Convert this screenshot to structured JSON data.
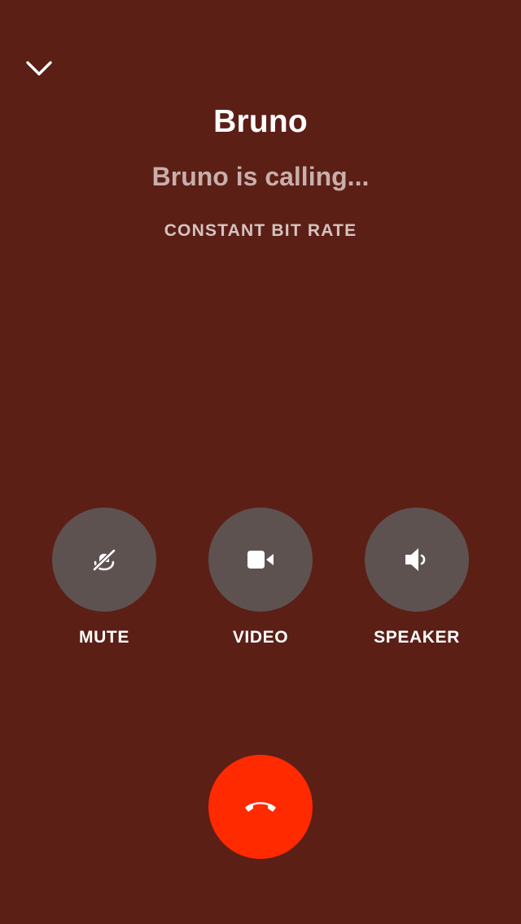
{
  "call": {
    "caller_name": "Bruno",
    "status": "Bruno is calling...",
    "quality": "CONSTANT BIT RATE"
  },
  "controls": [
    {
      "label": "MUTE",
      "icon": "mic-off-icon"
    },
    {
      "label": "VIDEO",
      "icon": "video-camera-icon"
    },
    {
      "label": "SPEAKER",
      "icon": "speaker-icon"
    }
  ],
  "actions": {
    "collapse_icon": "chevron-down-icon",
    "end_call_icon": "end-call-icon"
  },
  "colors": {
    "background": "#5b1f16",
    "control_button": "#5e5250",
    "end_call_button": "#ff2a00",
    "status_text": "#c9aeaa"
  }
}
